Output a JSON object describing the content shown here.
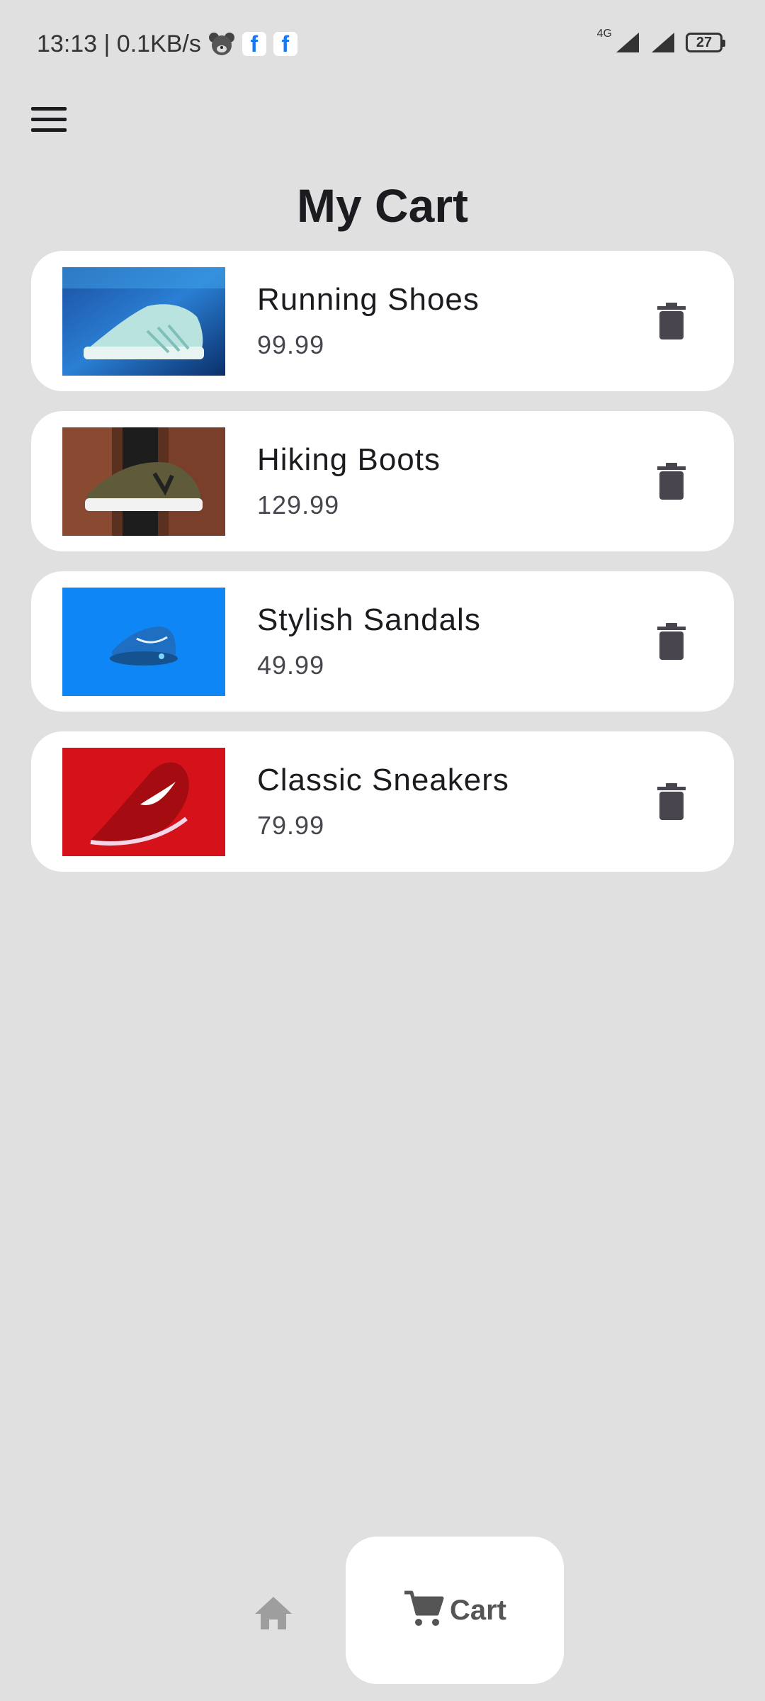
{
  "status_bar": {
    "time_speed": "13:13 | 0.1KB/s",
    "network": "4G",
    "battery": "27",
    "icons": [
      "bear-icon",
      "facebook-icon",
      "facebook-icon",
      "signal-icon",
      "signal-icon",
      "battery-icon"
    ]
  },
  "app_bar": {
    "menu_icon": "hamburger-menu-icon",
    "title": "My Cart"
  },
  "cart_items": [
    {
      "name": "Running Shoes",
      "price": "99.99",
      "image": "mint-running-shoe-on-blue"
    },
    {
      "name": "Hiking Boots",
      "price": "129.99",
      "image": "olive-sneaker-on-brick"
    },
    {
      "name": "Stylish Sandals",
      "price": "49.99",
      "image": "blue-sneaker-on-blue"
    },
    {
      "name": "Classic Sneakers",
      "price": "79.99",
      "image": "red-sneaker-on-red"
    }
  ],
  "delete_icon": "trash-icon",
  "bottom_nav": {
    "home_icon": "home-icon",
    "cart_icon": "cart-icon",
    "cart_label": "Cart"
  },
  "colors": {
    "background": "#e0e0e0",
    "card": "#ffffff",
    "text": "#1c1b1f",
    "price": "#49454f",
    "icon_dark": "#49454f",
    "home_inactive": "#9e9e9e"
  }
}
